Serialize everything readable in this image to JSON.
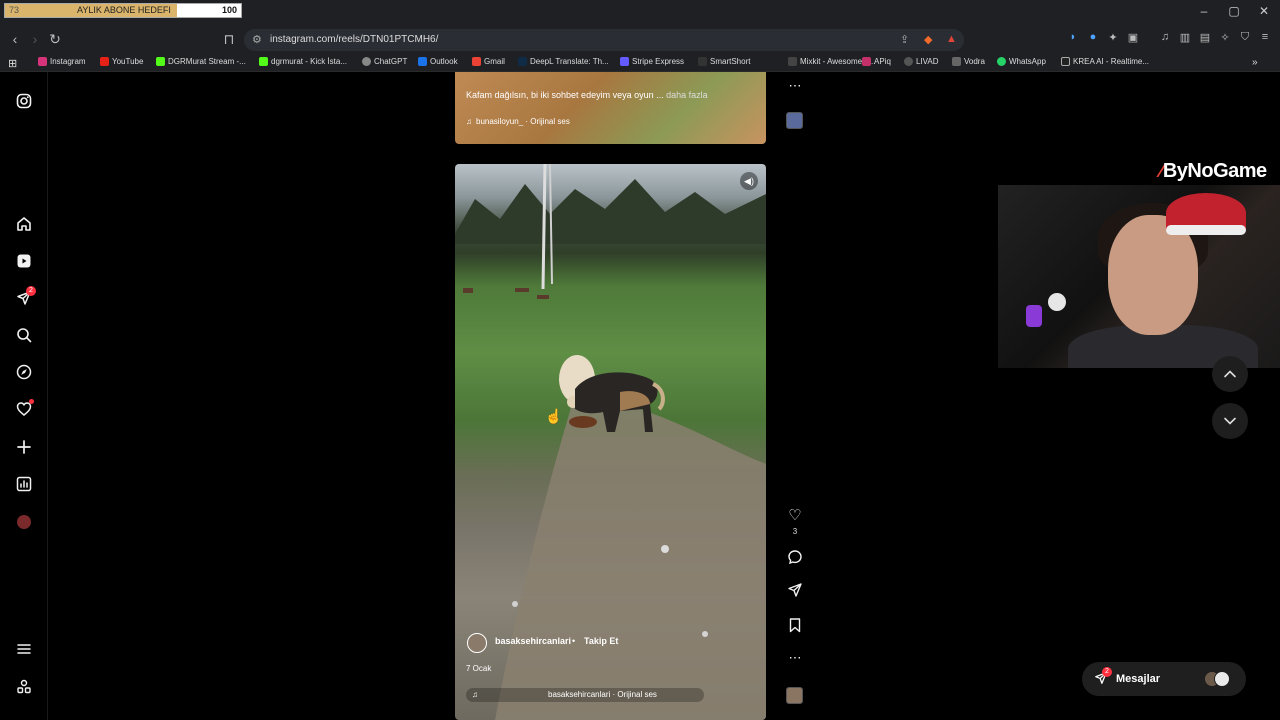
{
  "stream_goal": {
    "current": "73",
    "title": "AYLIK ABONE HEDEFI",
    "target": "100",
    "progress": 0.73
  },
  "browser": {
    "url": "instagram.com/reels/DTN01PTCMH6/",
    "bookmarks": [
      "Instagram",
      "YouTube",
      "DGRMurat Stream -...",
      "dgrmurat - Kick İsta...",
      "ChatGPT",
      "Outlook",
      "Gmail",
      "DeepL Translate: Th...",
      "Stripe Express",
      "SmartShort",
      "Mixkit - Awesome fr...",
      "APiq",
      "LIVAD",
      "Vodra",
      "WhatsApp",
      "KREA AI - Realtime..."
    ]
  },
  "left_nav": {
    "badge_count": "2"
  },
  "prev_reel": {
    "caption": "Kafam dağılsın, bi iki sohbet edeyim veya oyun ...",
    "more": "daha fazla",
    "audio": "bunasiloyun_ · Orijinal ses"
  },
  "reel": {
    "username": "basaksehircanlari",
    "separator": "•",
    "follow": "Takip Et",
    "date": "7 Ocak",
    "audio": "basaksehircanlari · Orijinal ses",
    "like_count": "3"
  },
  "overlay": {
    "logo": "ByNoGame"
  },
  "messages": {
    "label": "Mesajlar",
    "badge": "2"
  },
  "colors": {
    "accent_badge": "#ff3040",
    "brand_logo": "#e04030"
  }
}
